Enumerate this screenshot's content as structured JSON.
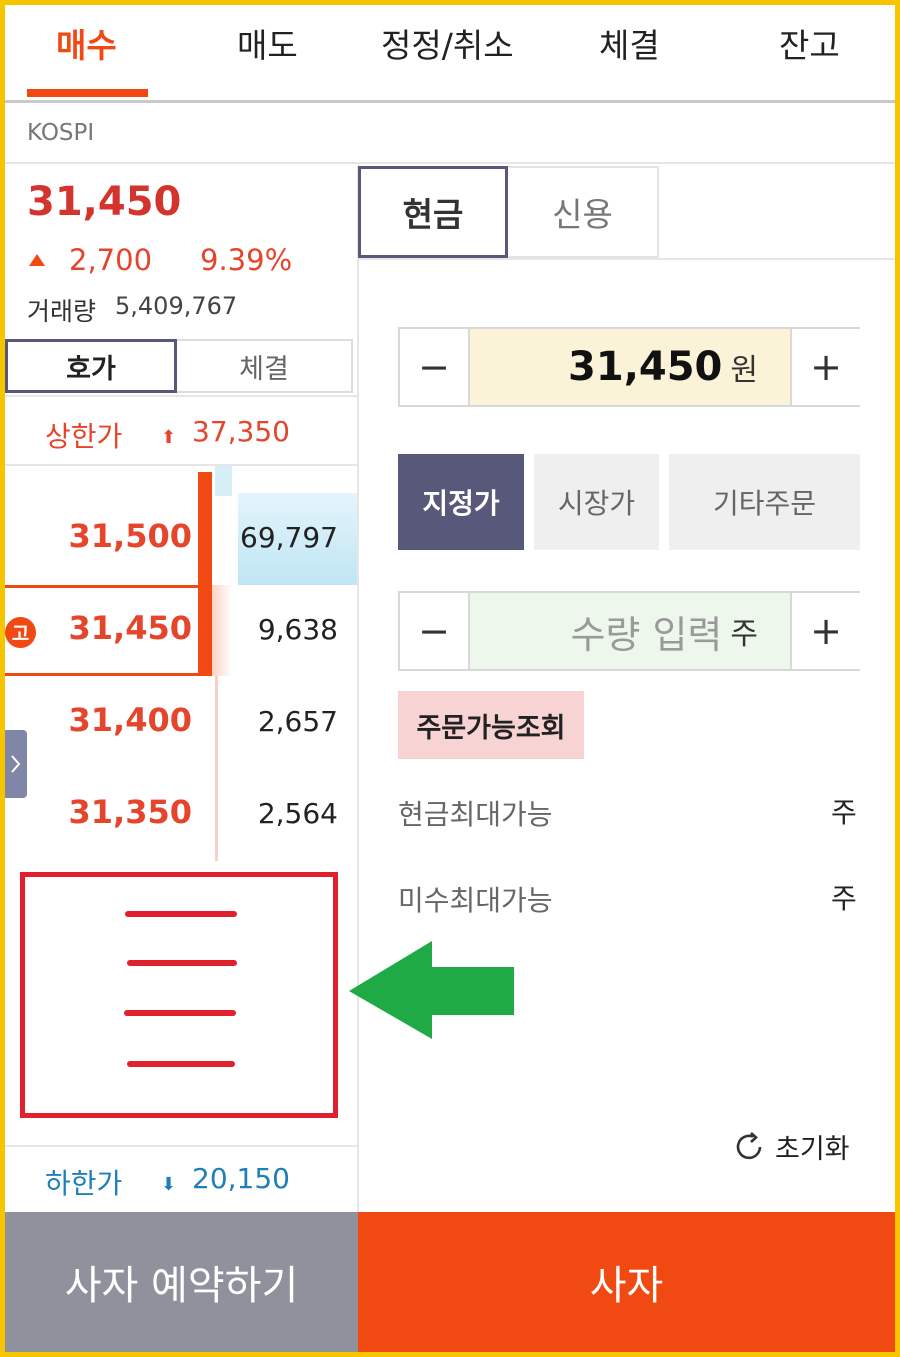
{
  "tabs": [
    "매수",
    "매도",
    "정정/취소",
    "체결",
    "잔고"
  ],
  "market": "KOSPI",
  "quote": {
    "price": "31,450",
    "change": "2,700",
    "change_pct": "9.39%",
    "volume_label": "거래량",
    "volume": "5,409,767"
  },
  "book_tabs": [
    "호가",
    "체결"
  ],
  "upper_limit": {
    "label": "상한가",
    "value": "37,350"
  },
  "lower_limit": {
    "label": "하한가",
    "value": "20,150"
  },
  "orderbook": [
    {
      "price": "31,500",
      "qty": "69,797"
    },
    {
      "price": "31,450",
      "qty": "9,638",
      "badge": "고"
    },
    {
      "price": "31,400",
      "qty": "2,657"
    },
    {
      "price": "31,350",
      "qty": "2,564"
    }
  ],
  "account_mode": [
    "현금",
    "신용"
  ],
  "price_input": {
    "value": "31,450",
    "unit": "원",
    "minus": "−",
    "plus": "+"
  },
  "order_types": [
    "지정가",
    "시장가",
    "기타주문"
  ],
  "qty_input": {
    "placeholder": "수량 입력",
    "unit": "주",
    "minus": "−",
    "plus": "+"
  },
  "avail_button": "주문가능조회",
  "info_rows": [
    {
      "label": "현금최대가능",
      "unit": "주"
    },
    {
      "label": "미수최대가능",
      "unit": "주"
    }
  ],
  "reset_label": "초기화",
  "bottom": {
    "reserve": "사자 예약하기",
    "buy": "사자"
  },
  "colors": {
    "accent": "#f04a12",
    "up": "#e5452b",
    "down": "#1f7fb8",
    "navy": "#58597a",
    "annotation_red": "#e0202c",
    "annotation_green": "#1faa46",
    "frame": "#f6c500"
  },
  "icons": {
    "side_toggle": "chevron-right-icon",
    "reset": "refresh-icon",
    "arrow": "left-arrow-icon",
    "menu": "hamburger-icon"
  }
}
